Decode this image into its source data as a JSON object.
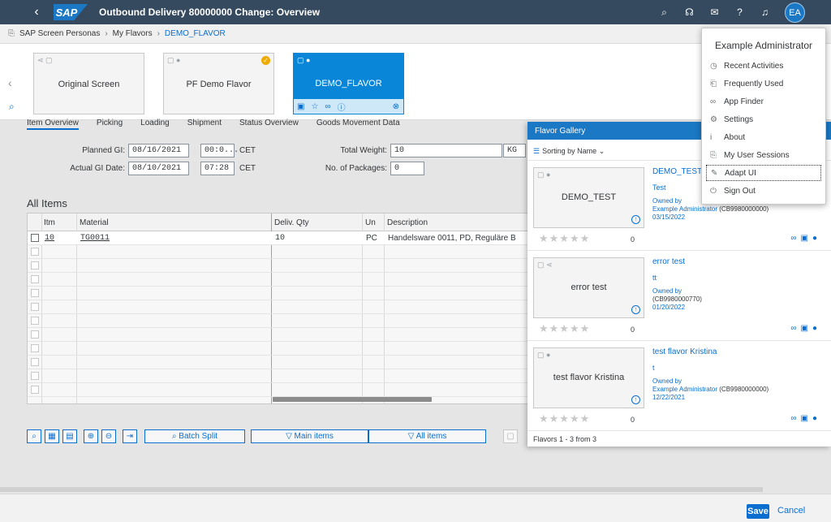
{
  "shell": {
    "back": "‹",
    "logo": "SAP",
    "title": "Outbound Delivery 80000000 Change: Overview",
    "icons": [
      "search-icon",
      "headset-icon",
      "chat-icon",
      "help-icon",
      "bell-icon"
    ],
    "avatar": "EA"
  },
  "breadcrumb": {
    "items": [
      "SAP Screen Personas",
      "My Flavors",
      "DEMO_FLAVOR"
    ]
  },
  "flavors": [
    {
      "name": "Original Screen",
      "active": false
    },
    {
      "name": "PF Demo Flavor",
      "active": false
    },
    {
      "name": "DEMO_FLAVOR",
      "active": true
    }
  ],
  "tabs": [
    "Item Overview",
    "Picking",
    "Loading",
    "Shipment",
    "Status Overview",
    "Goods Movement Data"
  ],
  "form": {
    "planned_gi_label": "Planned GI:",
    "planned_gi_date": "08/16/2021",
    "planned_gi_time": "00:0...",
    "planned_tz": "CET",
    "actual_gi_label": "Actual GI Date:",
    "actual_gi_date": "08/10/2021",
    "actual_gi_time": "07:28",
    "actual_tz": "CET",
    "total_weight_label": "Total Weight:",
    "total_weight": "10",
    "weight_unit": "KG",
    "packages_label": "No. of Packages:",
    "packages": "0"
  },
  "items": {
    "title": "All Items",
    "columns": [
      "Itm",
      "Material",
      "Deliv. Qty",
      "Un",
      "Description"
    ],
    "rows": [
      {
        "itm": "10",
        "material": "TG0011",
        "qty": "10",
        "un": "PC",
        "desc": "Handelsware 0011, PD, Reguläre B"
      }
    ]
  },
  "buttons": {
    "batch_split": "Batch Split",
    "main_items": "Main items",
    "all_items": "All items"
  },
  "gallery": {
    "title": "Flavor Gallery",
    "sort": "Sorting by Name",
    "owned_by": "Owned by",
    "items": [
      {
        "name": "DEMO_TEST",
        "desc": "Test",
        "owner": "Example Administrator",
        "owner_id": "(CB9980000000)",
        "date": "03/15/2022",
        "count": "0"
      },
      {
        "name": "error test",
        "desc": "tt",
        "owner": "",
        "owner_id": "(CB9980000770)",
        "date": "01/20/2022",
        "count": "0"
      },
      {
        "name": "test flavor Kristina",
        "desc": "t",
        "owner": "Example Administrator",
        "owner_id": "(CB9980000000)",
        "date": "12/22/2021",
        "count": "0"
      }
    ],
    "footer": "Flavors 1 - 3 from 3"
  },
  "user_menu": {
    "name": "Example Administrator",
    "items": [
      "Recent Activities",
      "Frequently Used",
      "App Finder",
      "Settings",
      "About",
      "My User Sessions",
      "Adapt UI",
      "Sign Out"
    ]
  },
  "footer": {
    "save": "Save",
    "cancel": "Cancel"
  }
}
